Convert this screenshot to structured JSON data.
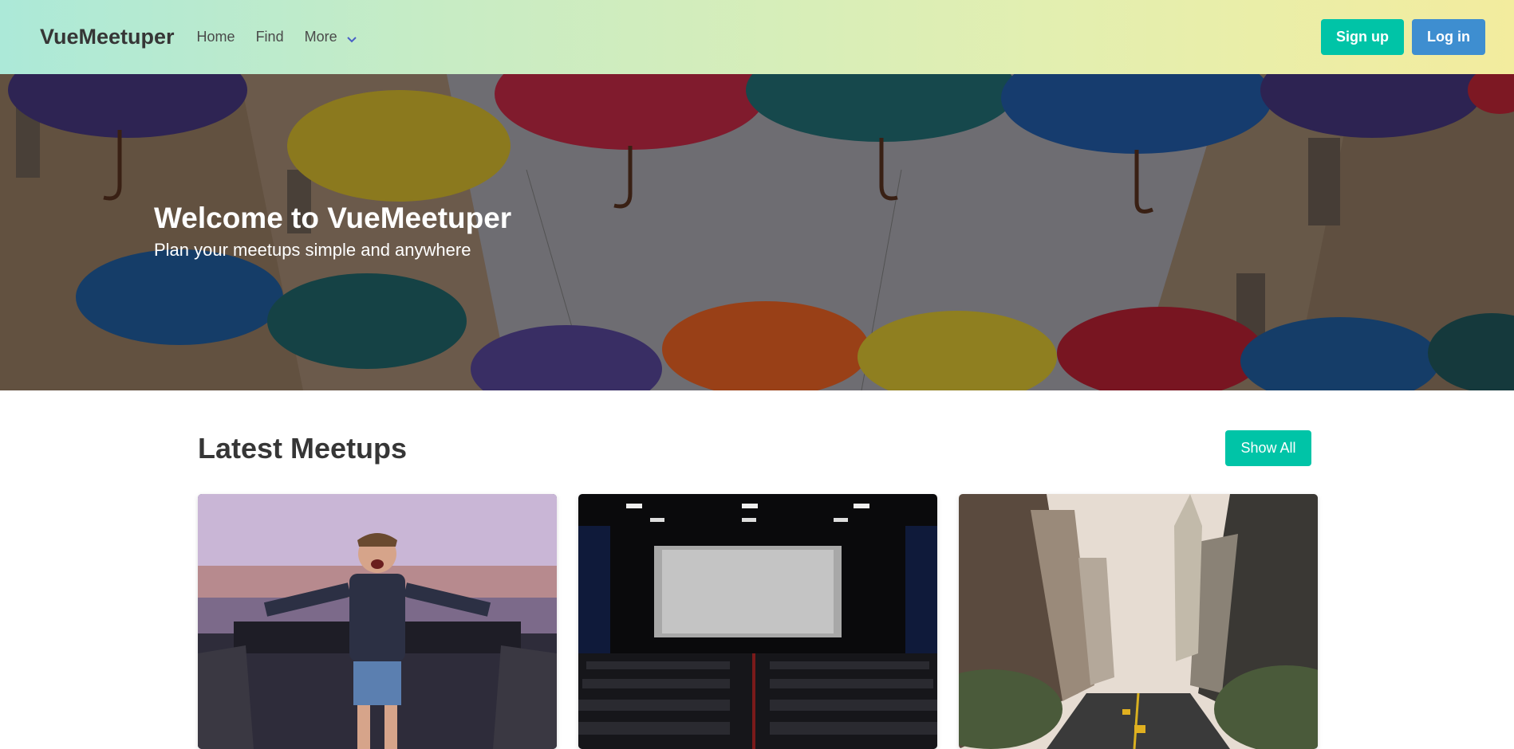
{
  "navbar": {
    "brand": "VueMeetuper",
    "links": [
      "Home",
      "Find",
      "More"
    ],
    "signup_label": "Sign up",
    "login_label": "Log in"
  },
  "hero": {
    "title": "Welcome to VueMeetuper",
    "subtitle": "Plan your meetups simple and anywhere"
  },
  "meetups": {
    "title": "Latest Meetups",
    "show_all_label": "Show All",
    "cards": [
      {
        "image": "dj-concert-photo"
      },
      {
        "image": "cinema-hall-photo"
      },
      {
        "image": "city-street-photo"
      }
    ]
  },
  "colors": {
    "primary": "#00c4a7",
    "info": "#3e8ed0",
    "text": "#363636"
  }
}
